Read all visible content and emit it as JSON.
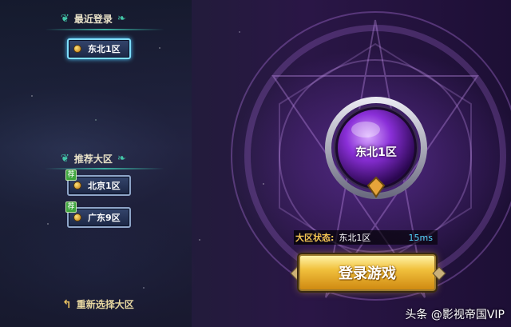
{
  "recent": {
    "header": "最近登录",
    "servers": [
      {
        "label": "东北1区",
        "selected": true
      }
    ]
  },
  "recommended": {
    "header": "推荐大区",
    "tag": "荐",
    "servers": [
      {
        "label": "北京1区"
      },
      {
        "label": "广东9区"
      }
    ]
  },
  "reselect_label": "重新选择大区",
  "current": {
    "orb_label": "东北1区",
    "status_label": "大区状态:",
    "status_server": "东北1区",
    "ping": "15ms"
  },
  "login_label": "登录游戏",
  "watermark": "头条 @影视帝国VIP"
}
